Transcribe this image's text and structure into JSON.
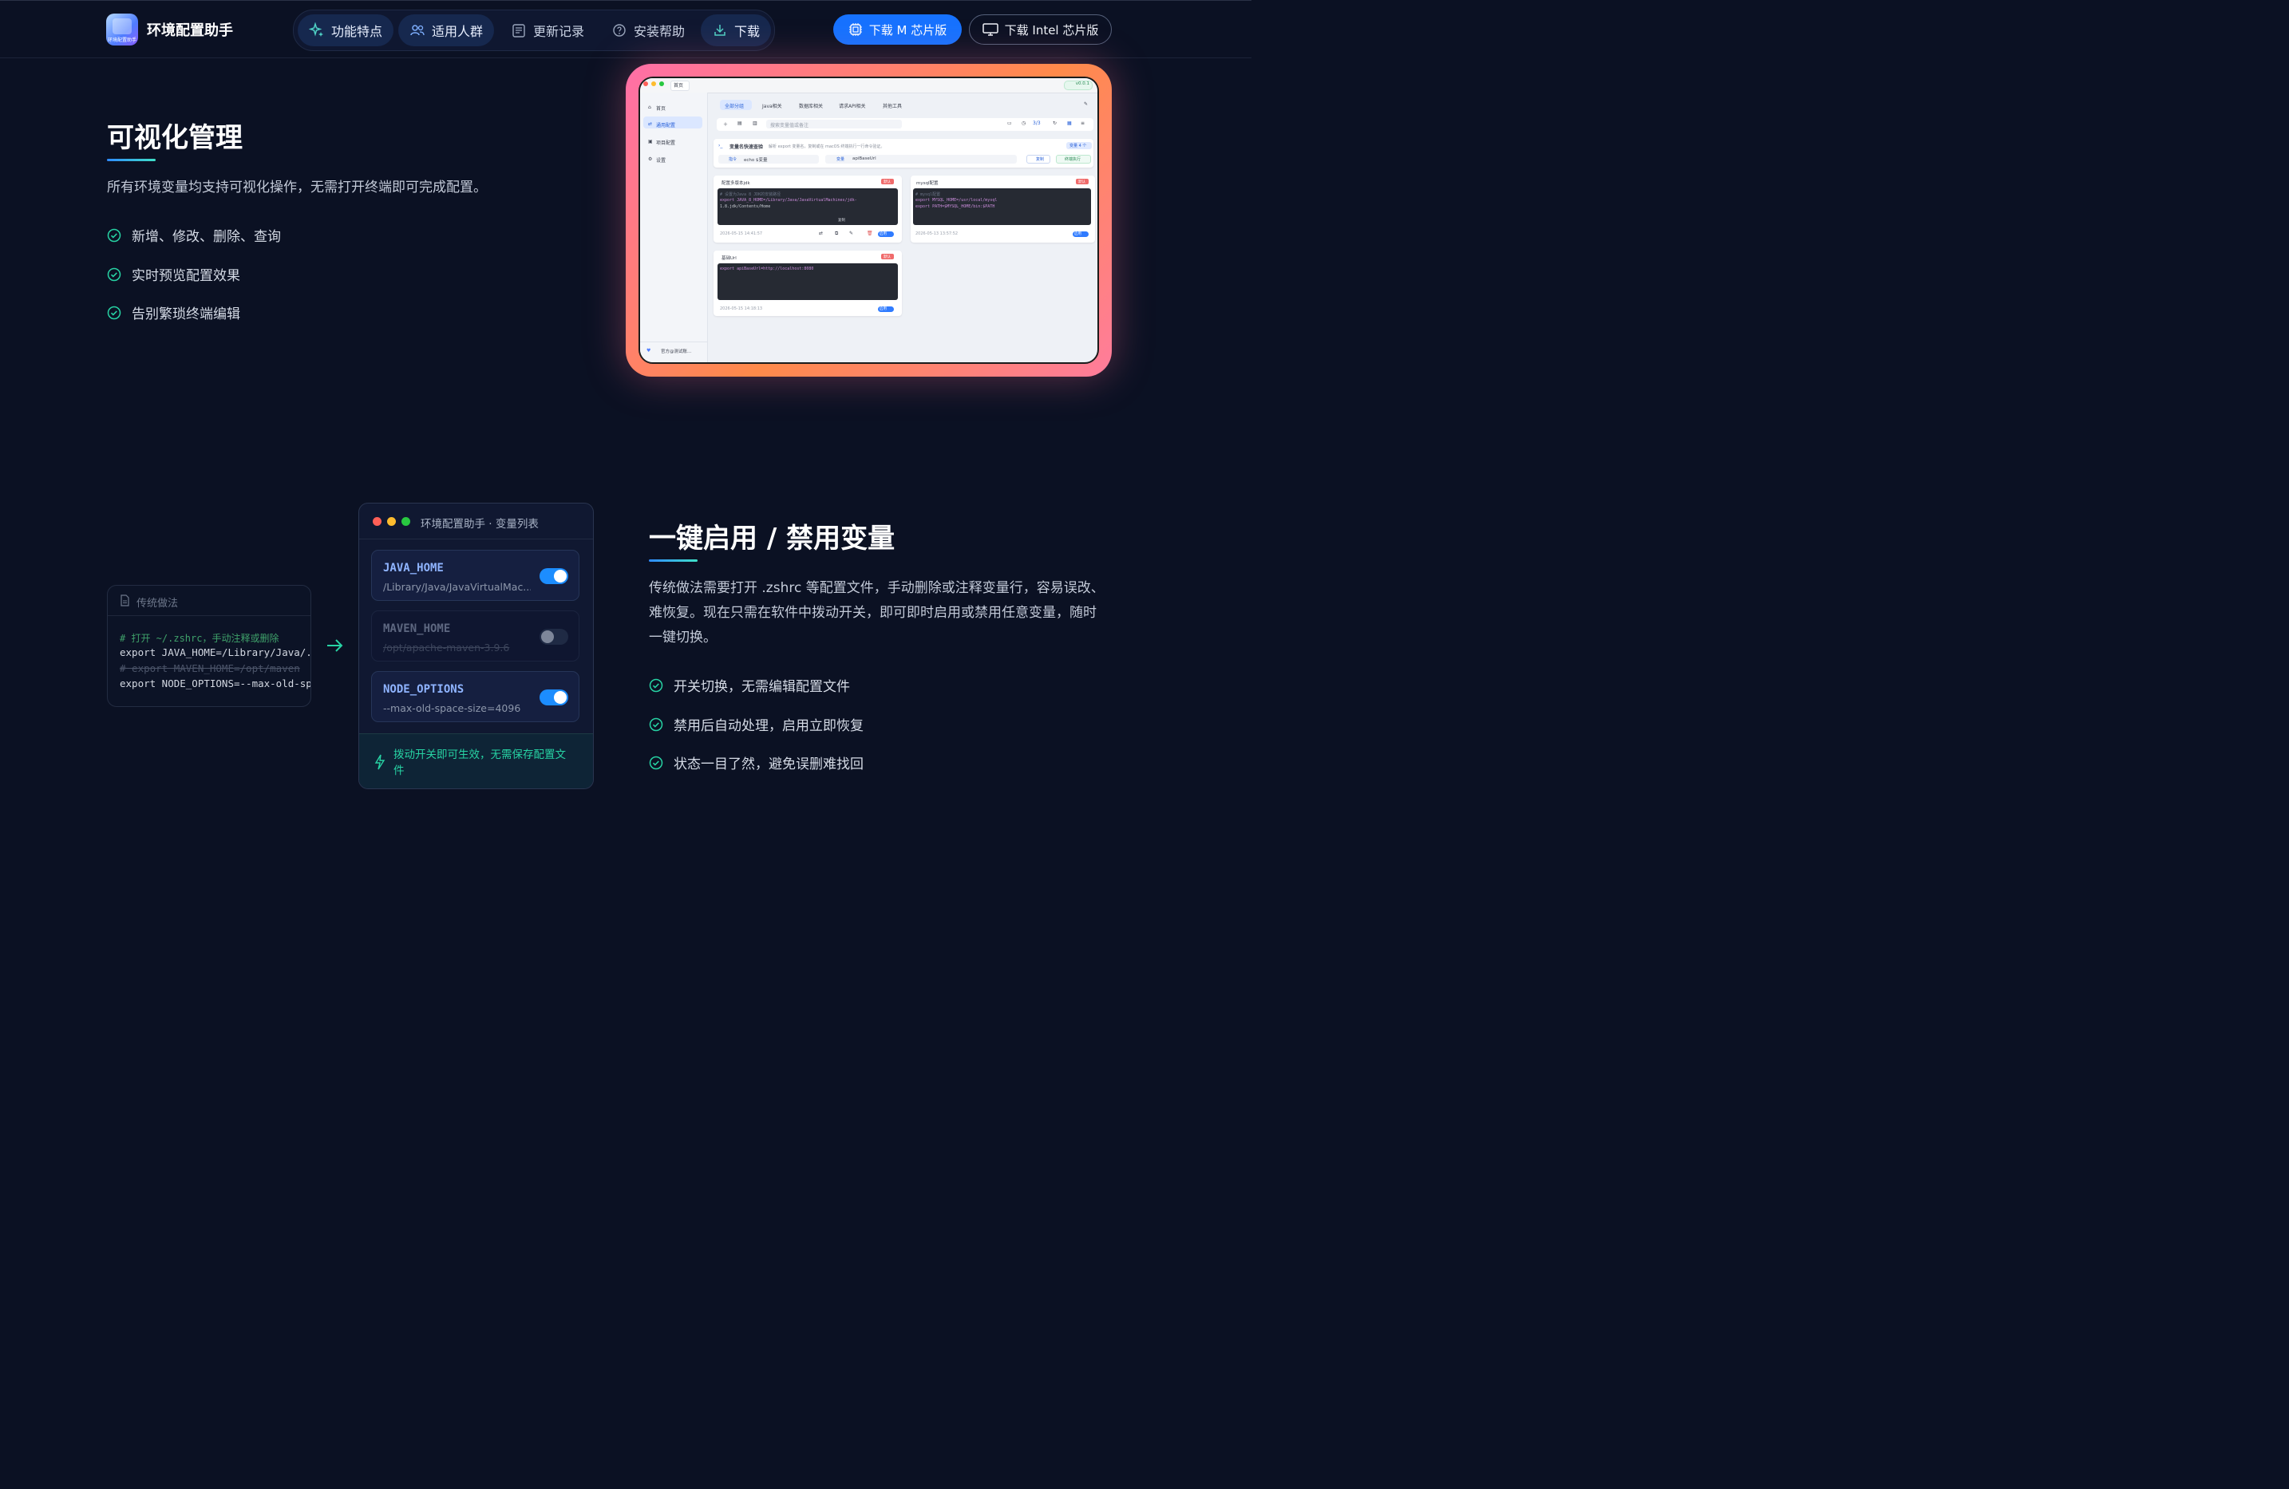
{
  "header": {
    "logo_caption": "环境配置助手",
    "brand": "环境配置助手",
    "nav": [
      {
        "label": "功能特点",
        "icon": "sparkles-icon",
        "active": true
      },
      {
        "label": "适用人群",
        "icon": "users-icon",
        "active": true
      },
      {
        "label": "更新记录",
        "icon": "document-list-icon",
        "active": false
      },
      {
        "label": "安装帮助",
        "icon": "help-circle-icon",
        "active": false
      },
      {
        "label": "下载",
        "icon": "download-icon",
        "active": true
      }
    ],
    "download_m": "下载 M 芯片版",
    "download_intel": "下载 Intel 芯片版"
  },
  "section1": {
    "title": "可视化管理",
    "desc": "所有环境变量均支持可视化操作，无需打开终端即可完成配置。",
    "checks": [
      "新增、修改、删除、查询",
      "实时预览配置效果",
      "告别繁琐终端编辑"
    ]
  },
  "screenshot": {
    "tab_title": "首页",
    "version": "v0.0.1",
    "sidebar": [
      "首页",
      "通用配置",
      "项目配置",
      "设置"
    ],
    "sidebar_footer": "官方@测试账...",
    "tabs": [
      "全部分组",
      "Java相关",
      "数据库相关",
      "请求API相关",
      "其他工具"
    ],
    "search_placeholder": "搜索变量值或备注",
    "counter": "3/3",
    "quick_title": "变量名快速查验",
    "quick_desc": "解析 export 变量名，复制或在 macOS 终端执行一行命令验证。",
    "quick_badge": "变量 4 个",
    "cmd_label": "指令",
    "cmd_value": "echo $变量",
    "var_label": "变量",
    "var_value": "apiBaseUrl",
    "copy_btn": "复制",
    "exec_btn": "终端执行",
    "cards": [
      {
        "title": "配置多版本jdk",
        "tag": "默认",
        "lines": [
          "# 设置为Java 8 JDK的安装路径",
          "export JAVA_8_HOME=/Library/Java/JavaVirtualMachines/jdk-",
          "1.8.jdk/Contents/Home"
        ],
        "copy_hint": "复制",
        "time": "2026-05-15 14:41:57",
        "toggle": "启用"
      },
      {
        "title": "mysql配置",
        "tag": "默认",
        "lines": [
          "# mysql配置",
          "export MYSQL_HOME=/usr/local/mysql",
          "export PATH=$MYSQL_HOME/bin:$PATH"
        ],
        "time": "2026-05-13 13:57:52",
        "toggle": "启用"
      },
      {
        "title": "基础Url",
        "tag": "默认",
        "lines": [
          "export apiBaseUrl=http://localhost:8080"
        ],
        "time": "2026-05-15 14:18:13",
        "toggle": "启用"
      }
    ]
  },
  "section2": {
    "title": "一键启用 / 禁用变量",
    "desc": "传统做法需要打开 .zshrc 等配置文件，手动删除或注释变量行，容易误改、难恢复。现在只需在软件中拨动开关，即可即时启用或禁用任意变量，随时一键切换。",
    "checks": [
      "开关切换，无需编辑配置文件",
      "禁用后自动处理，启用立即恢复",
      "状态一目了然，避免误删难找回"
    ]
  },
  "traditional": {
    "title": "传统做法",
    "lines": [
      {
        "text": "# 打开 ~/.zshrc，手动注释或删除",
        "style": "comment"
      },
      {
        "text": "export JAVA_HOME=/Library/Java/...",
        "style": "normal"
      },
      {
        "text": "# export MAVEN_HOME=/opt/maven",
        "style": "strike"
      },
      {
        "text": "export NODE_OPTIONS=--max-old-space",
        "style": "normal"
      }
    ]
  },
  "varlist": {
    "title": "环境配置助手 · 变量列表",
    "vars": [
      {
        "name": "JAVA_HOME",
        "value": "/Library/Java/JavaVirtualMac...",
        "enabled": true
      },
      {
        "name": "MAVEN_HOME",
        "value": "/opt/apache-maven-3.9.6",
        "enabled": false
      },
      {
        "name": "NODE_OPTIONS",
        "value": "--max-old-space-size=4096",
        "enabled": true
      }
    ],
    "footer": "拨动开关即可生效，无需保存配置文件"
  },
  "colors": {
    "accent": "#1672ff",
    "success": "#27d3a4",
    "frame": "#ff7a7a"
  }
}
